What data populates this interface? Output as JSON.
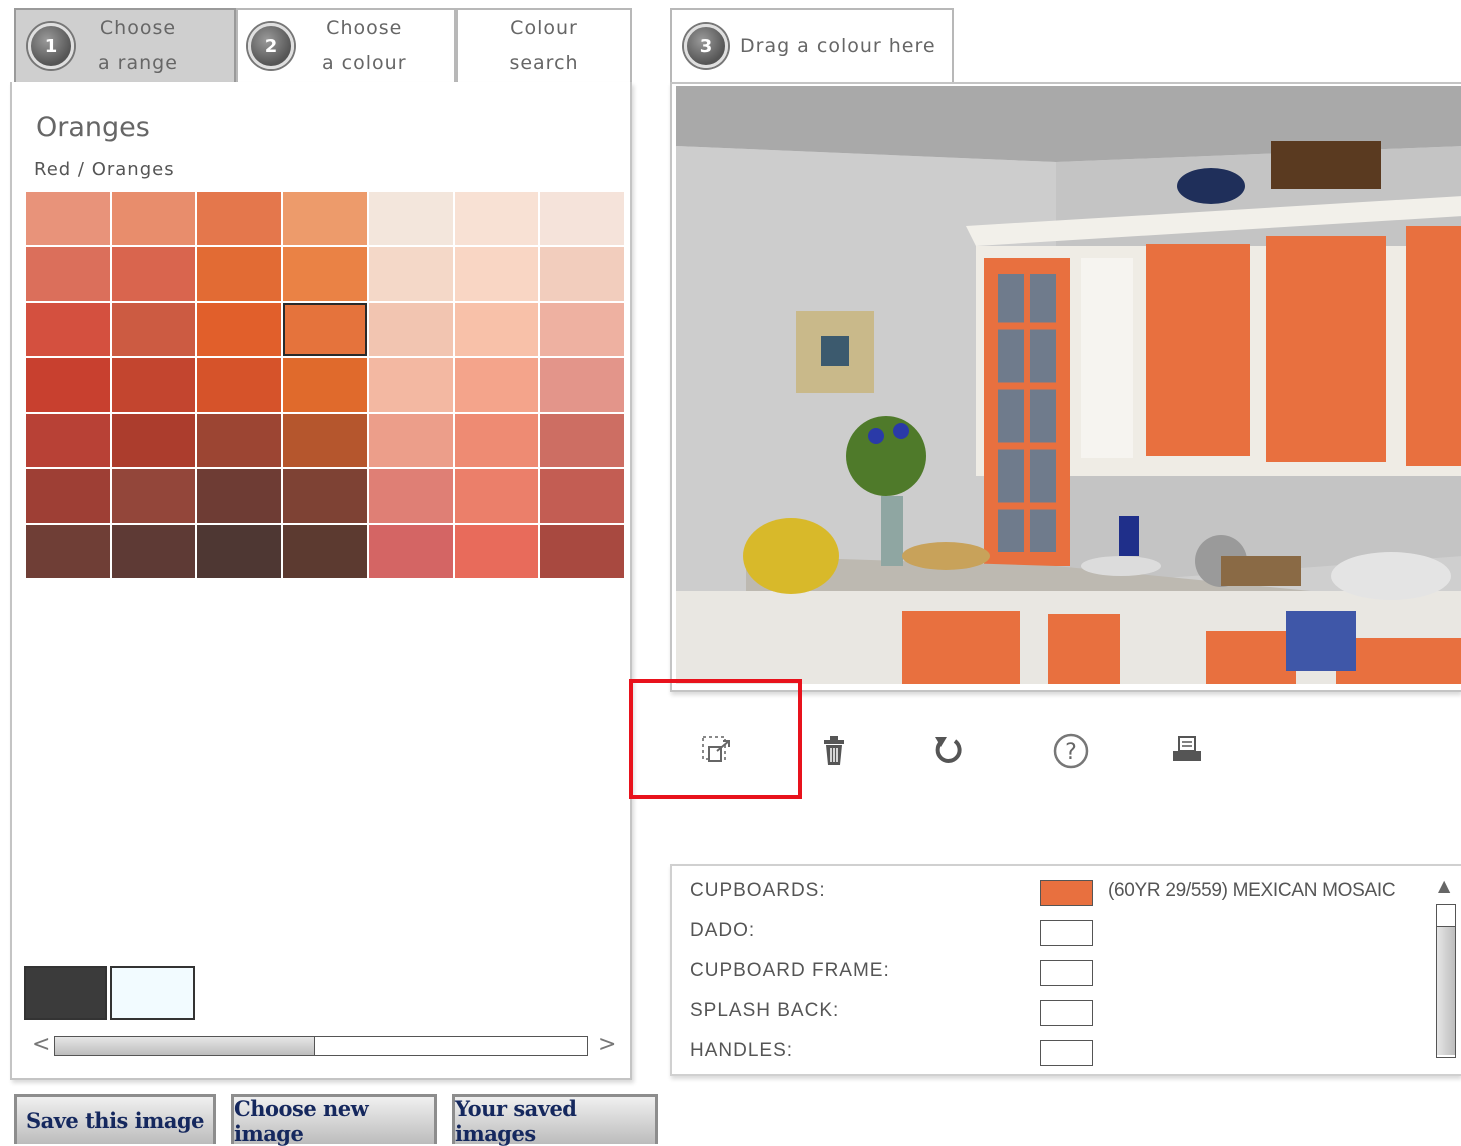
{
  "tabs": [
    {
      "num": "1",
      "line1": "Choose",
      "line2": "a range",
      "active": true
    },
    {
      "num": "2",
      "line1": "Choose",
      "line2": "a colour",
      "active": false
    },
    {
      "line1": "Colour",
      "line2": "search",
      "active": false
    }
  ],
  "drag_tab": {
    "num": "3",
    "label": "Drag a colour here"
  },
  "range": {
    "title": "Oranges",
    "subtitle": "Red / Oranges"
  },
  "colour_grid": [
    [
      "#e8937a",
      "#e88d6c",
      "#e4774c",
      "#ed9b6b",
      "#f3e6dc",
      "#f8e1d4",
      "#f5e3da"
    ],
    [
      "#db6f5b",
      "#d9654e",
      "#e26b34",
      "#ea8245",
      "#f4d8c8",
      "#f9d6c4",
      "#f2cdbd"
    ],
    [
      "#d4503f",
      "#cc5b42",
      "#e15f2b",
      "#e5733c",
      "#f2c5b1",
      "#f8c1a9",
      "#eeb1a1"
    ],
    [
      "#c8402f",
      "#c3452f",
      "#d6532a",
      "#e06a2c",
      "#f3b8a2",
      "#f4a48b",
      "#e3958a"
    ],
    [
      "#b84136",
      "#ac3d2d",
      "#9c4533",
      "#b5562d",
      "#ec9e8a",
      "#ee8b73",
      "#cd6e63"
    ],
    [
      "#9e3f35",
      "#93463a",
      "#6e3c34",
      "#7e4234",
      "#df7f75",
      "#eb7f6a",
      "#c35d53"
    ],
    [
      "#6f3e36",
      "#5e3a35",
      "#4e3733",
      "#5c3a30",
      "#d46564",
      "#e86b5b",
      "#a84940"
    ]
  ],
  "selected_cell": {
    "row": 2,
    "col": 3
  },
  "recent_swatches": [
    "#3b3b3b",
    "#f2fbff"
  ],
  "buttons": {
    "save": "Save this image",
    "choose_new": "Choose new image",
    "saved": "Your saved images"
  },
  "tools": [
    "select-area-icon",
    "trash-icon",
    "undo-icon",
    "help-icon",
    "print-icon"
  ],
  "assignments": [
    {
      "label": "CUPBOARDS:",
      "color": "#e8703f",
      "value": "(60YR 29/559) MEXICAN MOSAIC"
    },
    {
      "label": "DADO:",
      "color": "#ffffff",
      "value": ""
    },
    {
      "label": "CUPBOARD FRAME:",
      "color": "#ffffff",
      "value": ""
    },
    {
      "label": "SPLASH BACK:",
      "color": "#ffffff",
      "value": ""
    },
    {
      "label": "HANDLES:",
      "color": "#ffffff",
      "value": ""
    }
  ],
  "colors": {
    "accent_orange": "#e8703f",
    "button_text": "#15285e",
    "highlight": "#e8121c"
  }
}
